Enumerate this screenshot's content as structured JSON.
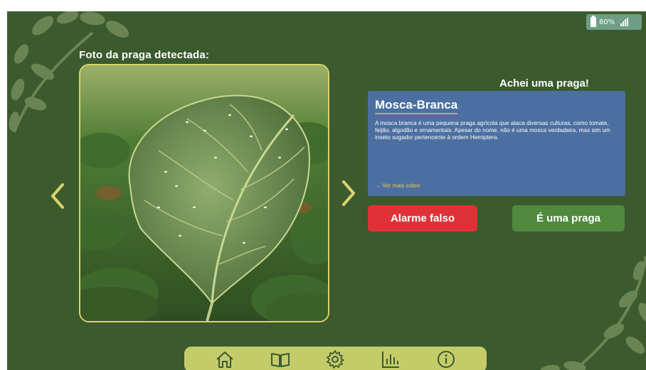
{
  "status_bar": {
    "battery_percent": "80%",
    "signal_icon": "signal-icon",
    "battery_icon": "battery-icon"
  },
  "photo": {
    "title": "Foto da praga detectada:",
    "prev_icon": "chevron-left-icon",
    "next_icon": "chevron-right-icon"
  },
  "detection": {
    "heading": "Achei uma praga!",
    "pest_name": "Mosca-Branca",
    "description": "A mosca branca é uma pequena praga agrícola que ataca diversas culturas, como tomate, feijão, algodão e ornamentais. Apesar do nome, não é uma mosca verdadeira, mas sim um inseto sugador pertencente à ordem Hemiptera.",
    "more_link": "→ Ver mais sobre"
  },
  "actions": {
    "false_alarm": "Alarme falso",
    "is_pest": "É uma praga"
  },
  "nav": {
    "items": [
      {
        "icon": "home-icon"
      },
      {
        "icon": "book-icon"
      },
      {
        "icon": "gear-icon"
      },
      {
        "icon": "bar-chart-icon"
      },
      {
        "icon": "info-icon"
      }
    ]
  },
  "colors": {
    "background": "#3b5a2e",
    "accent": "#c4cc6a",
    "card": "#4b6fa0",
    "danger": "#e03236",
    "success": "#4f8a3f",
    "link": "#f3c641"
  }
}
